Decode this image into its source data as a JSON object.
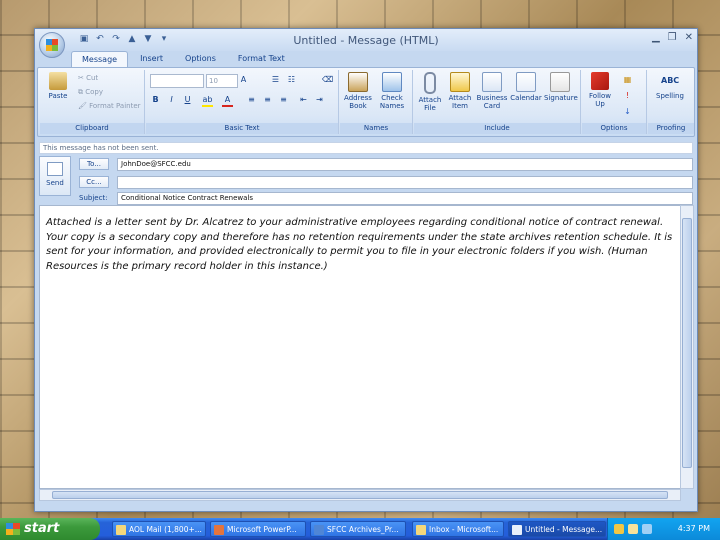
{
  "window": {
    "title": "Untitled - Message (HTML)",
    "quick_access": [
      "save-icon",
      "undo-icon",
      "redo-icon",
      "up-icon",
      "down-icon",
      "customize-icon"
    ]
  },
  "tabs": [
    {
      "label": "Message",
      "active": true
    },
    {
      "label": "Insert",
      "active": false
    },
    {
      "label": "Options",
      "active": false
    },
    {
      "label": "Format Text",
      "active": false
    }
  ],
  "ribbon": {
    "clipboard": {
      "paste": "Paste",
      "cut": "Cut",
      "copy": "Copy",
      "format_painter": "Format Painter",
      "label": "Clipboard"
    },
    "basic_text": {
      "font_size": "10",
      "label": "Basic Text"
    },
    "names": {
      "address_book": "Address Book",
      "check_names": "Check Names",
      "label": "Names"
    },
    "include": {
      "attach_file": "Attach File",
      "attach_item": "Attach Item",
      "business_card": "Business Card",
      "calendar": "Calendar",
      "signature": "Signature",
      "label": "Include"
    },
    "options": {
      "follow_up": "Follow Up",
      "label": "Options"
    },
    "proofing": {
      "spelling": "Spelling",
      "label": "Proofing",
      "abc": "ABC"
    }
  },
  "infobar": "This message has not been sent.",
  "compose": {
    "send": "Send",
    "to_label": "To...",
    "to_value": "JohnDoe@SFCC.edu",
    "cc_label": "Cc...",
    "cc_value": "",
    "subject_label": "Subject:",
    "subject_value": "Conditional Notice Contract Renewals"
  },
  "body_text": "Attached is a letter sent by Dr. Alcatrez to your administrative employees regarding conditional notice of contract renewal. Your copy is a secondary copy and therefore has no retention requirements under the state archives retention schedule. It is sent for your information, and provided electronically to permit you to file in your electronic folders if you wish. (Human Resources is the primary record holder in this instance.)",
  "taskbar": {
    "start": "start",
    "tasks": [
      {
        "label": "AOL Mail (1,800+..."
      },
      {
        "label": "Microsoft PowerP..."
      },
      {
        "label": "SFCC Archives_Pr..."
      },
      {
        "label": "Inbox - Microsoft..."
      },
      {
        "label": "Untitled - Message..."
      }
    ],
    "clock": "4:37 PM"
  }
}
